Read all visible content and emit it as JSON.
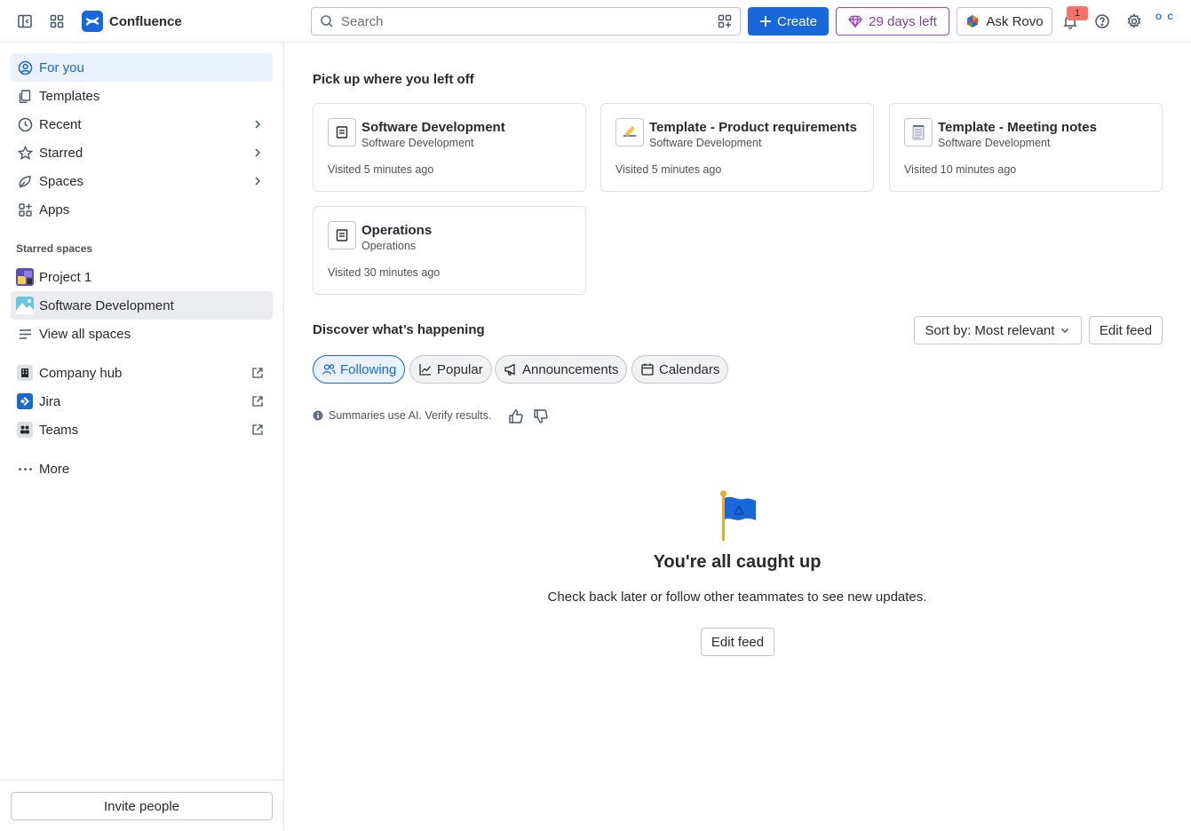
{
  "app": {
    "name": "Confluence"
  },
  "topbar": {
    "search_placeholder": "Search",
    "create_label": "Create",
    "trial_label": "29 days left",
    "rovo_label": "Ask Rovo",
    "notification_count": "1",
    "avatar_initials": "O C",
    "colors": {
      "primary": "#1868db",
      "trial": "#803fa5",
      "badge": "#f87168"
    }
  },
  "sidebar": {
    "nav": [
      {
        "label": "For you",
        "icon": "user-circle-icon"
      },
      {
        "label": "Templates",
        "icon": "templates-icon"
      },
      {
        "label": "Recent",
        "icon": "clock-icon"
      },
      {
        "label": "Starred",
        "icon": "star-icon"
      },
      {
        "label": "Spaces",
        "icon": "spaces-icon"
      },
      {
        "label": "Apps",
        "icon": "apps-icon"
      }
    ],
    "starred_spaces_label": "Starred spaces",
    "spaces": [
      {
        "label": "Project 1"
      },
      {
        "label": "Software Development"
      },
      {
        "label": "View all spaces"
      }
    ],
    "apps": [
      {
        "label": "Company hub"
      },
      {
        "label": "Jira"
      },
      {
        "label": "Teams"
      }
    ],
    "more_label": "More",
    "invite_label": "Invite people"
  },
  "main": {
    "pickup_heading": "Pick up where you left off",
    "recent_cards": [
      {
        "title": "Software Development",
        "space": "Software Development",
        "visited": "Visited 5 minutes ago",
        "icon": "page-icon"
      },
      {
        "title": "Template - Product requirements",
        "space": "Software Development",
        "visited": "Visited 5 minutes ago",
        "icon": "writing-hand-emoji"
      },
      {
        "title": "Template - Meeting notes",
        "space": "Software Development",
        "visited": "Visited 10 minutes ago",
        "icon": "notepad-emoji"
      },
      {
        "title": "Operations",
        "space": "Operations",
        "visited": "Visited 30 minutes ago",
        "icon": "page-icon"
      }
    ],
    "discover_heading": "Discover what’s happening",
    "sort_label": "Sort by: Most relevant",
    "edit_feed_label": "Edit feed",
    "tabs": [
      {
        "label": "Following"
      },
      {
        "label": "Popular"
      },
      {
        "label": "Announcements"
      },
      {
        "label": "Calendars"
      }
    ],
    "ai_note": "Summaries use AI. Verify results.",
    "empty_state": {
      "title": "You're all caught up",
      "message": "Check back later or follow other teammates to see new updates.",
      "button_label": "Edit feed"
    }
  }
}
